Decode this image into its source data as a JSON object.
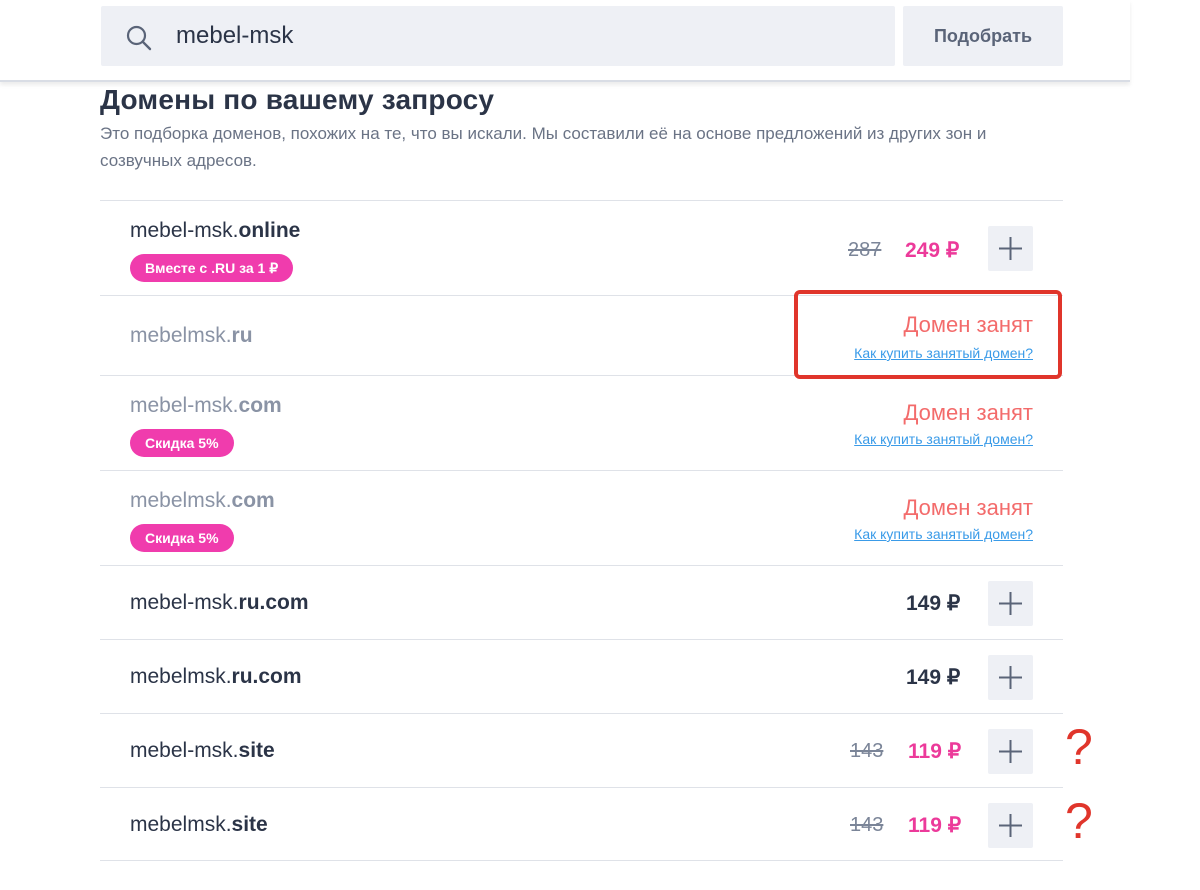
{
  "search": {
    "value": "mebel-msk",
    "button_label": "Подобрать"
  },
  "header": {
    "title": "Домены по вашему запросу",
    "subtitle": "Это подборка доменов, похожих на те, что вы искали. Мы составили её на основе предложений из других зон и созвучных адресов."
  },
  "domains": [
    {
      "name": "mebel-msk.",
      "zone": "online",
      "badge": "Вместе с .RU за 1 ₽",
      "old_price": "287",
      "price": "249 ₽",
      "status": "available"
    },
    {
      "name": "mebelmsk.",
      "zone": "ru",
      "status": "taken",
      "status_label": "Домен занят",
      "status_link": "Как купить занятый домен?"
    },
    {
      "name": "mebel-msk.",
      "zone": "com",
      "badge": "Скидка 5%",
      "status": "taken",
      "status_label": "Домен занят",
      "status_link": "Как купить занятый домен?"
    },
    {
      "name": "mebelmsk.",
      "zone": "com",
      "badge": "Скидка 5%",
      "status": "taken",
      "status_label": "Домен занят",
      "status_link": "Как купить занятый домен?"
    },
    {
      "name": "mebel-msk.",
      "zone": "ru.com",
      "price": "149 ₽",
      "status": "available"
    },
    {
      "name": "mebelmsk.",
      "zone": "ru.com",
      "price": "149 ₽",
      "status": "available"
    },
    {
      "name": "mebel-msk.",
      "zone": "site",
      "old_price": "143",
      "price": "119 ₽",
      "status": "available"
    },
    {
      "name": "mebelmsk.",
      "zone": "site",
      "old_price": "143",
      "price": "119 ₽",
      "status": "available"
    }
  ],
  "annotations": {
    "question_mark_1": "?",
    "question_mark_2": "?"
  },
  "colors": {
    "accent_pink": "#ec3a9a",
    "badge_pink": "#f03cad",
    "taken_red": "#f36b6b",
    "link_blue": "#3a9be8",
    "annotation_red": "#e0352b"
  }
}
